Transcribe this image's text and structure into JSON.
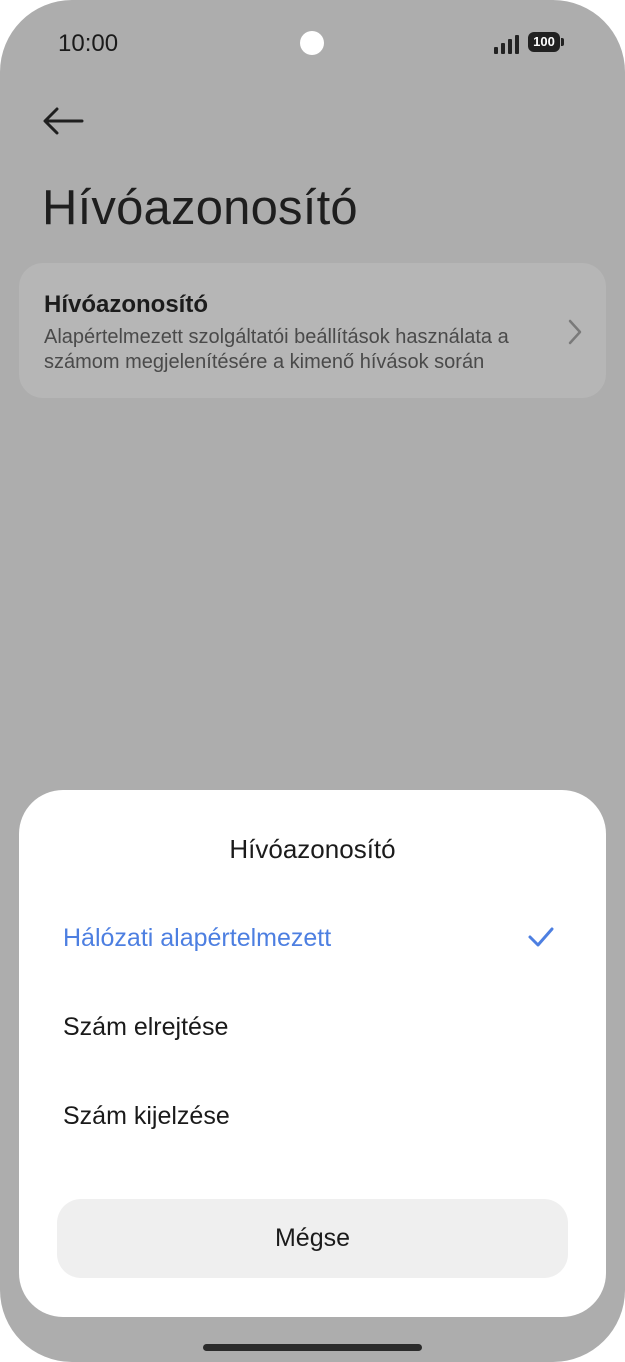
{
  "status": {
    "time": "10:00",
    "battery": "100"
  },
  "page": {
    "title": "Hívóazonosító",
    "back_icon": "back-arrow-icon",
    "card": {
      "title": "Hívóazonosító",
      "subtitle": "Alapértelmezett szolgáltatói beállítások használata a számom megjelenítésére a kimenő hívások során",
      "chevron_icon": "chevron-right-icon"
    }
  },
  "dialog": {
    "title": "Hívóazonosító",
    "options": [
      {
        "label": "Hálózati alapértelmezett",
        "selected": true
      },
      {
        "label": "Szám elrejtése",
        "selected": false
      },
      {
        "label": "Szám kijelzése",
        "selected": false
      }
    ],
    "cancel_label": "Mégse",
    "accent_color": "#4d7fe1"
  }
}
